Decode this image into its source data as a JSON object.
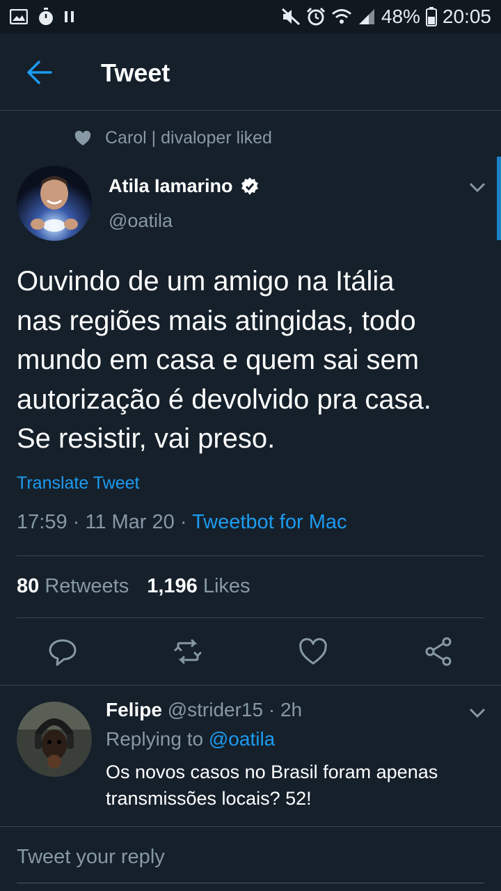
{
  "status_bar": {
    "battery": "48%",
    "time": "20:05"
  },
  "app_bar": {
    "title": "Tweet"
  },
  "social_context": {
    "text": "Carol | divaloper liked"
  },
  "tweet": {
    "author_name": "Atila Iamarino",
    "author_handle": "@oatila",
    "verified": true,
    "lines": [
      "Ouvindo de um amigo na Itália",
      "nas regiões mais atingidas, todo",
      "mundo em casa e quem sai sem",
      "autorização é devolvido pra casa.",
      "Se resistir, vai preso."
    ],
    "translate_label": "Translate Tweet",
    "time": "17:59",
    "date": "11 Mar 20",
    "source": "Tweetbot for Mac",
    "retweet_count": "80",
    "retweet_label": "Retweets",
    "like_count": "1,196",
    "like_label": "Likes"
  },
  "actions": {
    "icons": [
      "reply-icon",
      "retweet-icon",
      "like-icon",
      "share-icon"
    ]
  },
  "reply": {
    "author_name": "Felipe",
    "author_handle": "@strider15",
    "time_ago": "2h",
    "replying_prefix": "Replying to",
    "replying_to": "@oatila",
    "text_lines": [
      "Os novos casos no Brasil foram apenas",
      "transmissões locais? 52!"
    ]
  },
  "compose": {
    "placeholder": "Tweet your reply"
  },
  "colors": {
    "background": "#15202b",
    "accent": "#1d9bf0",
    "secondary_text": "#8899a6",
    "divider": "#38444d"
  }
}
